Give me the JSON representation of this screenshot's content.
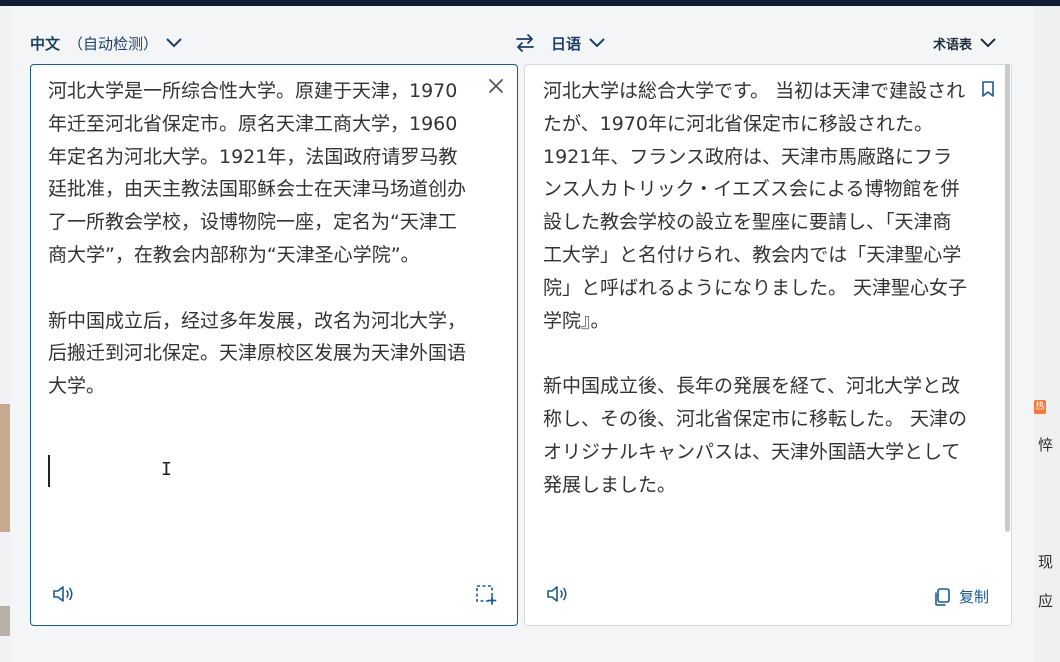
{
  "source": {
    "language": "中文",
    "detect_label": "（自动检测）",
    "text": "河北大学是一所综合性大学。原建于天津，1970年迁至河北省保定市。原名天津工商大学，1960年定名为河北大学。1921年，法国政府请罗马教廷批准，由天主教法国耶稣会士在天津马场道创办了一所教会学校，设博物院一座，定名为“天津工商大学”，在教会内部称为“天津圣心学院”。\n\n新中国成立后，经过多年发展，改名为河北大学，后搬迁到河北保定。天津原校区发展为天津外国语大学。"
  },
  "target": {
    "language": "日语",
    "text": "河北大学は総合大学です。 当初は天津で建設されたが、1970年に河北省保定市に移設された。 1921年、フランス政府は、天津市馬廠路にフランス人カトリック・イエズス会による博物館を併設した教会学校の設立を聖座に要請し、「天津商工大学」と名付けられ、教会内では「天津聖心学院」と呼ばれるようになりました。 天津聖心女子学院』。\n\n新中国成立後、長年の発展を経て、河北大学と改称し、その後、河北省保定市に移転した。 天津のオリジナルキャンパスは、天津外国語大学として発展しました。",
    "copy_label": "复制"
  },
  "glossary_label": "术语表",
  "background": {
    "right_fragments": [
      "悴",
      "现",
      "应"
    ],
    "hot_badge": "热"
  },
  "colors": {
    "accent": "#1c5a8c",
    "title": "#1c3f66",
    "topbar": "#0f1e33"
  },
  "icons": {
    "swap": "swap-arrows-icon",
    "close": "close-icon",
    "bookmark": "bookmark-icon",
    "speaker": "speaker-icon",
    "screenshot": "screenshot-icon",
    "copy": "copy-icon",
    "chevron": "chevron-down-icon"
  }
}
